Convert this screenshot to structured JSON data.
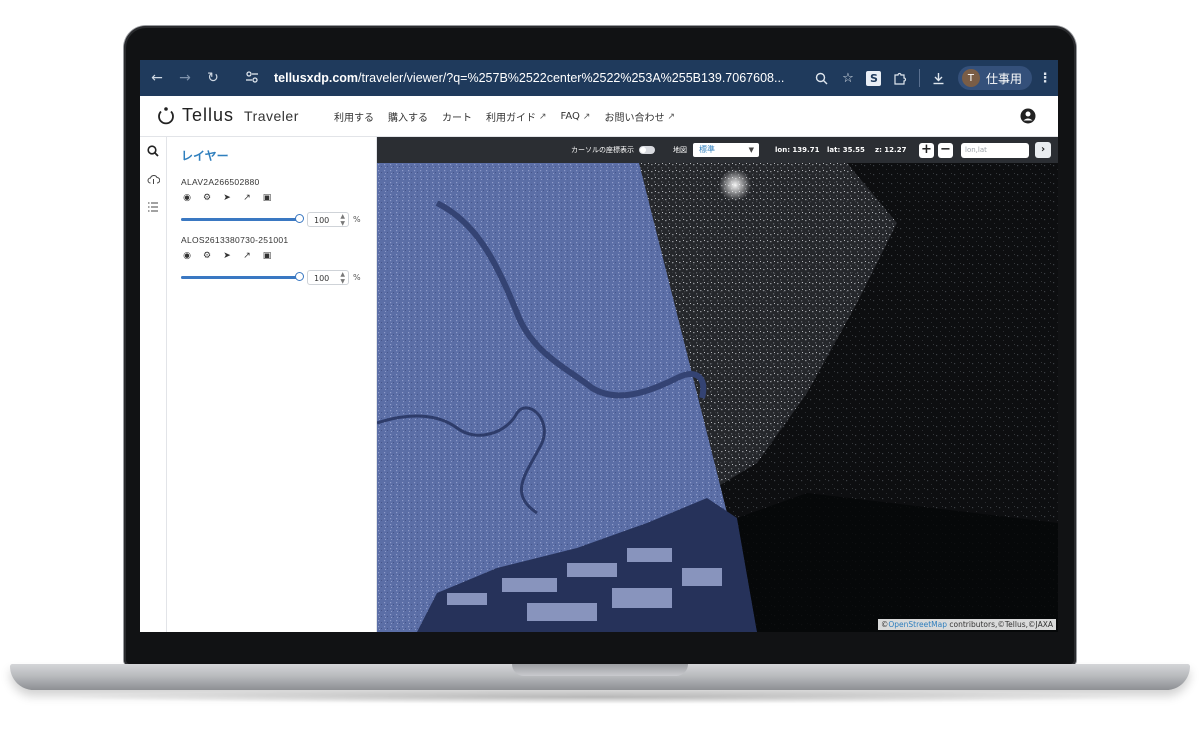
{
  "browser": {
    "url_domain": "tellusxdp.com",
    "url_path": "/traveler/viewer/?q=%257B%2522center%2522%253A%255B139.7067608...",
    "profile_initial": "T",
    "profile_name": "仕事用"
  },
  "app": {
    "logo_name": "Tellus",
    "logo_sub": "Traveler",
    "nav": [
      {
        "label": "利用する",
        "external": false
      },
      {
        "label": "購入する",
        "external": false
      },
      {
        "label": "カート",
        "external": false
      },
      {
        "label": "利用ガイド",
        "external": true
      },
      {
        "label": "FAQ",
        "external": true
      },
      {
        "label": "お問い合わせ",
        "external": true
      }
    ]
  },
  "panel": {
    "title": "レイヤー",
    "layers": [
      {
        "name": "ALAV2A266502880",
        "opacity": "100",
        "opacity_fraction": 1.0,
        "unit": "%"
      },
      {
        "name": "ALOS2613380730-251001",
        "opacity": "100",
        "opacity_fraction": 1.0,
        "unit": "%"
      }
    ]
  },
  "map_toolbar": {
    "cursor_label": "カーソルの座標表示",
    "basemap_label": "地図",
    "basemap_value": "標準",
    "lon": "lon: 139.71",
    "lat": "lat: 35.55",
    "zoom": "z: 12.27",
    "search_placeholder": "lon,lat"
  },
  "map": {
    "attribution_prefix": "©",
    "attribution_osm": "OpenStreetMap",
    "attribution_suffix": " contributors,©Tellus,©JAXA"
  },
  "colors": {
    "chrome_bg": "#1f3a5c",
    "accent": "#2f7fbe",
    "optical_tint": "#5b6ea6",
    "sar_bg": "#0d0e10"
  }
}
